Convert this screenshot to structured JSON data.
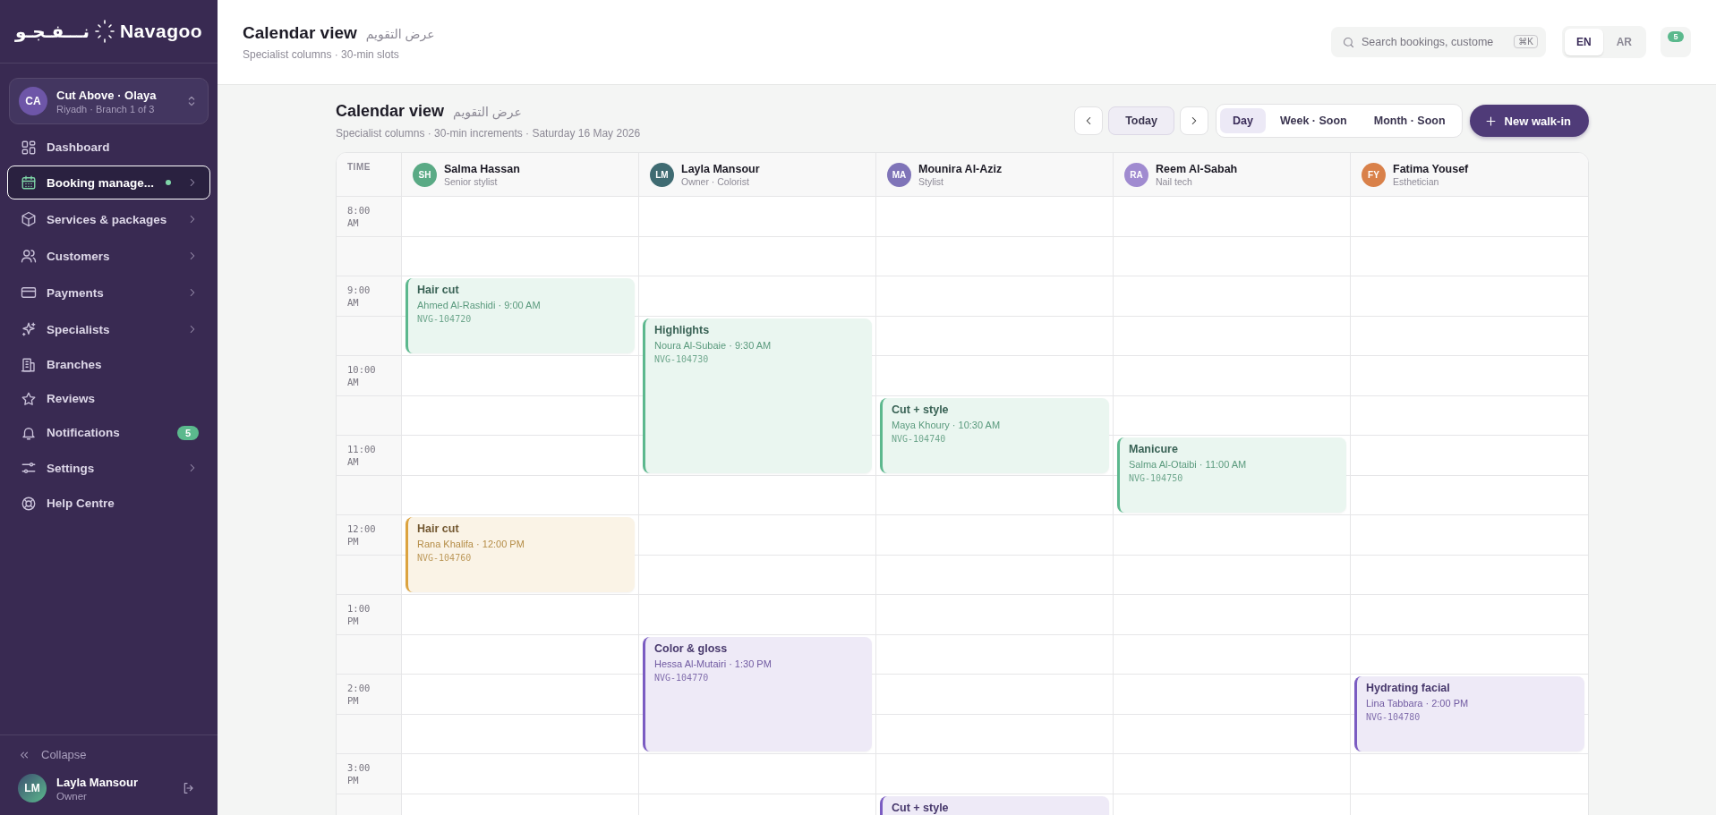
{
  "sidebar": {
    "logo": {
      "arabic": "نـــفـجـو",
      "latin": "Navagoo"
    },
    "branch": {
      "initials": "CA",
      "name": "Cut Above · Olaya",
      "detail": "Riyadh · Branch 1 of 3"
    },
    "nav": [
      {
        "label": "Dashboard",
        "selected": false,
        "submenu": false,
        "dot": false
      },
      {
        "label": "Booking manage...",
        "selected": true,
        "submenu": true,
        "dot": true
      },
      {
        "label": "Services & packages",
        "selected": false,
        "submenu": true,
        "dot": false
      },
      {
        "label": "Customers",
        "selected": false,
        "submenu": true,
        "dot": false
      },
      {
        "label": "Payments",
        "selected": false,
        "submenu": true,
        "dot": false
      },
      {
        "label": "Specialists",
        "selected": false,
        "submenu": true,
        "dot": false
      },
      {
        "label": "Branches",
        "selected": false,
        "submenu": false,
        "dot": false
      },
      {
        "label": "Reviews",
        "selected": false,
        "submenu": false,
        "dot": false
      },
      {
        "label": "Notifications",
        "selected": false,
        "submenu": false,
        "dot": false,
        "badge": "5"
      },
      {
        "label": "Settings",
        "selected": false,
        "submenu": true,
        "dot": false
      },
      {
        "label": "Help Centre",
        "selected": false,
        "submenu": false,
        "dot": false
      }
    ],
    "collapse": "Collapse",
    "user": {
      "initials": "LM",
      "name": "Layla Mansour",
      "role": "Owner"
    }
  },
  "header": {
    "title": "Calendar view",
    "title_ar": "عرض التقويم",
    "subtitle": "Specialist columns · 30-min slots",
    "search": {
      "placeholder": "Search bookings, custome",
      "shortcut": "⌘K"
    },
    "languages": [
      {
        "label": "EN",
        "selected": true
      },
      {
        "label": "AR",
        "selected": false
      }
    ],
    "notifications_badge": "5"
  },
  "page": {
    "title": "Calendar view",
    "title_ar": "عرض التقويم",
    "subtitle": "Specialist columns · 30-min increments · Saturday 16 May 2026",
    "today": "Today",
    "views": [
      {
        "label": "Day",
        "selected": true
      },
      {
        "label": "Week · Soon",
        "selected": false
      },
      {
        "label": "Month · Soon",
        "selected": false
      }
    ],
    "new_button": "New walk-in"
  },
  "calendar": {
    "time_heading": "TIME",
    "hours": [
      "8:00 AM",
      "9:00 AM",
      "10:00 AM",
      "11:00 AM",
      "12:00 PM",
      "1:00 PM",
      "2:00 PM",
      "3:00 PM"
    ],
    "specialists": [
      {
        "initials": "SH",
        "name": "Salma Hassan",
        "role": "Senior stylist",
        "color": "#5aaa85",
        "slots": [
          {
            "booked": false
          },
          {
            "booked": false
          },
          {
            "booked": true,
            "service": "Hair cut",
            "client": "Ahmed Al-Rashidi · 9:00 AM",
            "ref": "NVG-104720",
            "color": "#5cb88e"
          },
          {
            "booked": true
          },
          {
            "booked": false
          },
          {
            "booked": false
          },
          {
            "booked": false
          },
          {
            "booked": false
          },
          {
            "booked": true,
            "service": "Hair cut",
            "client": "Rana Khalifa · 12:00 PM",
            "ref": "NVG-104760",
            "color": "#dca33f"
          },
          {
            "booked": true
          },
          {
            "booked": false
          },
          {
            "booked": false
          },
          {
            "booked": false
          },
          {
            "booked": false
          },
          {
            "booked": false
          },
          {
            "booked": false
          }
        ]
      },
      {
        "initials": "LM",
        "name": "Layla Mansour",
        "role": "Owner · Colorist",
        "color": "#3f6b72",
        "slots": [
          {
            "booked": false
          },
          {
            "booked": false
          },
          {
            "booked": false
          },
          {
            "booked": true,
            "service": "Highlights",
            "client": "Noura Al-Subaie · 9:30 AM",
            "ref": "NVG-104730",
            "color": "#5cb88e"
          },
          {
            "booked": true
          },
          {
            "booked": true
          },
          {
            "booked": true
          },
          {
            "booked": false
          },
          {
            "booked": false
          },
          {
            "booked": false
          },
          {
            "booked": false
          },
          {
            "booked": true,
            "service": "Color & gloss",
            "client": "Hessa Al-Mutairi · 1:30 PM",
            "ref": "NVG-104770",
            "color": "#7b5cc2"
          },
          {
            "booked": true
          },
          {
            "booked": true
          },
          {
            "booked": false
          },
          {
            "booked": false
          }
        ]
      },
      {
        "initials": "MA",
        "name": "Mounira Al-Aziz",
        "role": "Stylist",
        "color": "#7f74b8",
        "slots": [
          {
            "booked": false
          },
          {
            "booked": false
          },
          {
            "booked": false
          },
          {
            "booked": false
          },
          {
            "booked": false
          },
          {
            "booked": true,
            "service": "Cut + style",
            "client": "Maya Khoury · 10:30 AM",
            "ref": "NVG-104740",
            "color": "#5cb88e"
          },
          {
            "booked": true
          },
          {
            "booked": false
          },
          {
            "booked": false
          },
          {
            "booked": false
          },
          {
            "booked": false
          },
          {
            "booked": false
          },
          {
            "booked": false
          },
          {
            "booked": false
          },
          {
            "booked": false
          },
          {
            "booked": true,
            "service": "Cut + style",
            "color": "#7b5cc2"
          }
        ]
      },
      {
        "initials": "RA",
        "name": "Reem Al-Sabah",
        "role": "Nail tech",
        "color": "#a08bd0",
        "slots": [
          {
            "booked": false
          },
          {
            "booked": false
          },
          {
            "booked": false
          },
          {
            "booked": false
          },
          {
            "booked": false
          },
          {
            "booked": false
          },
          {
            "booked": true,
            "service": "Manicure",
            "client": "Salma Al-Otaibi · 11:00 AM",
            "ref": "NVG-104750",
            "color": "#5cb88e"
          },
          {
            "booked": true
          },
          {
            "booked": false
          },
          {
            "booked": false
          },
          {
            "booked": false
          },
          {
            "booked": false
          },
          {
            "booked": false
          },
          {
            "booked": false
          },
          {
            "booked": false
          },
          {
            "booked": false
          }
        ]
      },
      {
        "initials": "FY",
        "name": "Fatima Yousef",
        "role": "Esthetician",
        "color": "#d9814a",
        "slots": [
          {
            "booked": false
          },
          {
            "booked": false
          },
          {
            "booked": false
          },
          {
            "booked": false
          },
          {
            "booked": false
          },
          {
            "booked": false
          },
          {
            "booked": false
          },
          {
            "booked": false
          },
          {
            "booked": false
          },
          {
            "booked": false
          },
          {
            "booked": false
          },
          {
            "booked": false
          },
          {
            "booked": true,
            "service": "Hydrating facial",
            "client": "Lina Tabbara · 2:00 PM",
            "ref": "NVG-104780",
            "color": "#7b5cc2"
          },
          {
            "booked": true
          },
          {
            "booked": false
          },
          {
            "booked": false
          }
        ]
      }
    ]
  }
}
